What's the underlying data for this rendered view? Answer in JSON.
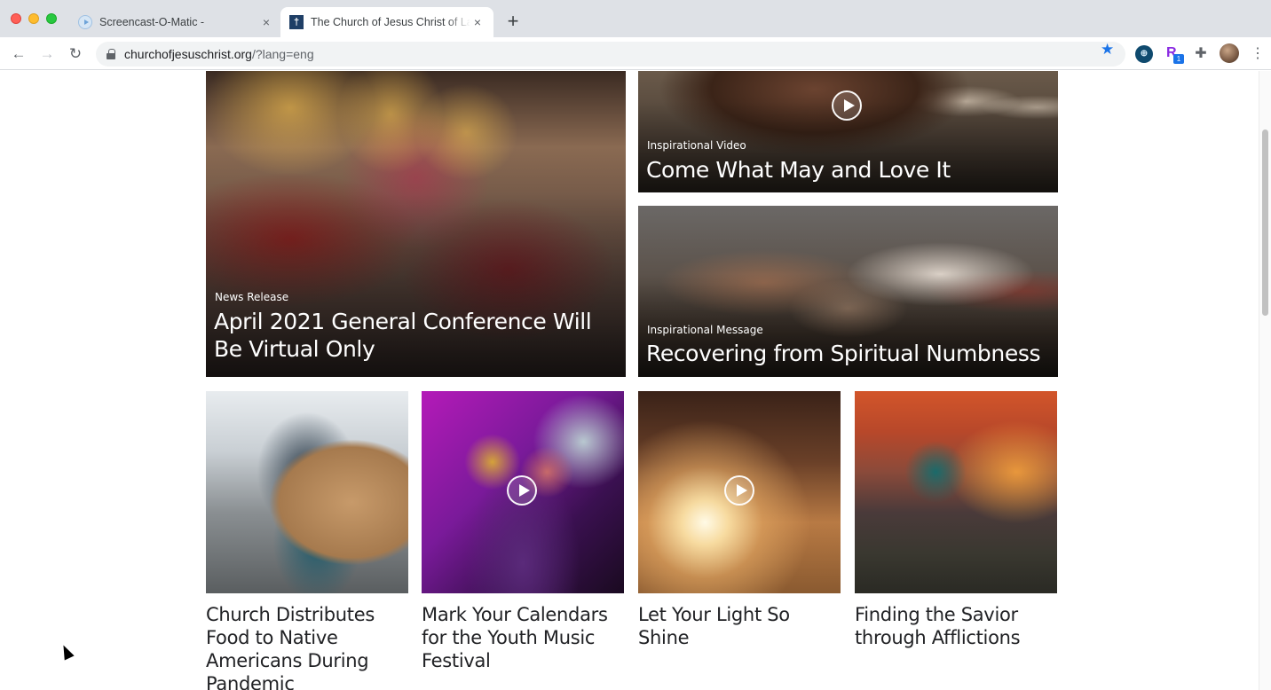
{
  "browser": {
    "tabs": [
      {
        "title": "Screencast-O-Matic -",
        "favicon": "screencast-icon",
        "active": false
      },
      {
        "title": "The Church of Jesus Christ of Latter-day Saints",
        "favicon": "church-icon",
        "active": true
      }
    ],
    "new_tab_label": "+",
    "close_glyph": "×",
    "url_host": "churchofjesuschrist.org",
    "url_path": "/?lang=eng",
    "nav": {
      "back": "←",
      "forward": "→",
      "reload": "↻"
    },
    "bookmark_star": "★",
    "extensions": [
      {
        "name": "globe-extension",
        "glyph": "⊕"
      },
      {
        "name": "r-extension",
        "glyph": "R",
        "badge": "1"
      },
      {
        "name": "extensions-puzzle",
        "glyph": "✚"
      }
    ],
    "menu_glyph": "⋮"
  },
  "featured": [
    {
      "kicker": "News Release",
      "headline": "April 2021 General Conference Will Be Virtual Only",
      "has_video": false
    },
    {
      "kicker": "Inspirational Video",
      "headline": "Come What May and Love It",
      "has_video": true
    },
    {
      "kicker": "Inspirational Message",
      "headline": "Recovering from Spiritual Numbness",
      "has_video": false
    }
  ],
  "tiles": [
    {
      "title": "Church Distributes Food to Native Americans During Pandemic",
      "has_video": false
    },
    {
      "title": "Mark Your Calendars for the Youth Music Festival",
      "has_video": true
    },
    {
      "title": "Let Your Light So Shine",
      "has_video": true
    },
    {
      "title": "Finding the Savior through Afflictions",
      "has_video": false
    }
  ]
}
